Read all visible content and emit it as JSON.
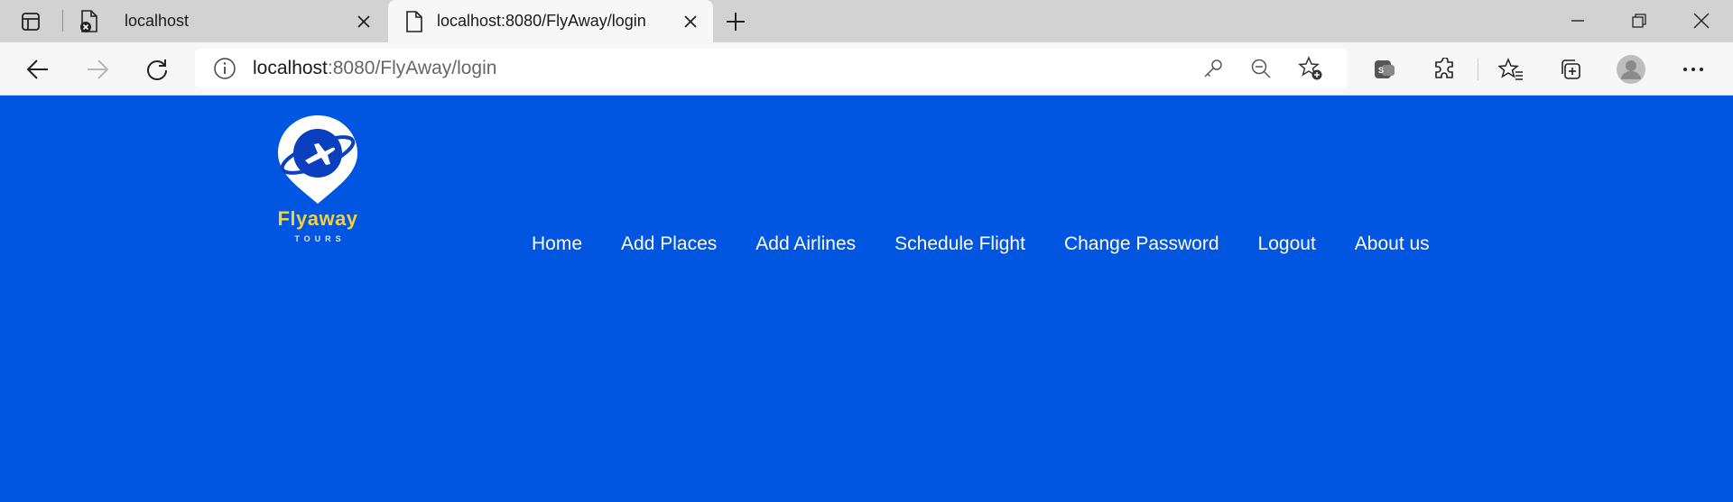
{
  "browser": {
    "tabs": [
      {
        "title": "localhost",
        "favicon": "page-error-icon",
        "active": false
      },
      {
        "title": "localhost:8080/FlyAway/login",
        "favicon": "page-icon",
        "active": true
      }
    ],
    "address": {
      "host": "localhost",
      "path": ":8080/FlyAway/login"
    }
  },
  "site": {
    "logo": {
      "brand": "Flyaway",
      "subtitle": "TOURS"
    },
    "nav": [
      {
        "label": "Home"
      },
      {
        "label": "Add Places"
      },
      {
        "label": "Add Airlines"
      },
      {
        "label": "Schedule Flight"
      },
      {
        "label": "Change Password"
      },
      {
        "label": "Logout"
      },
      {
        "label": "About us"
      }
    ]
  },
  "colors": {
    "page_background": "#0056e0",
    "brand_yellow": "#f2d13a",
    "tabstrip": "#d2d2d2",
    "toolbar": "#f7f7f7"
  }
}
